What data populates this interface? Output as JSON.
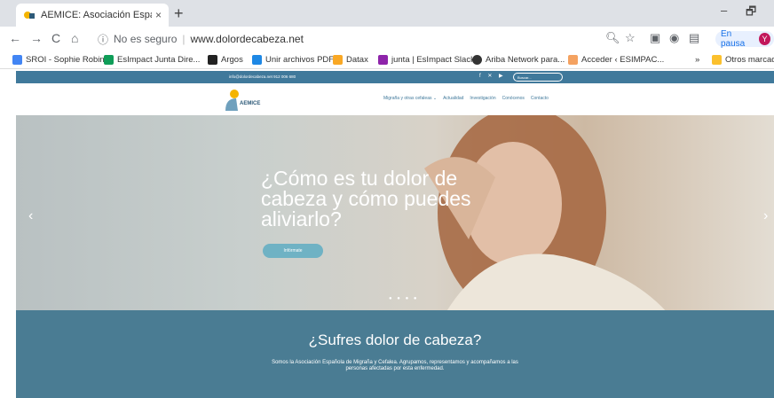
{
  "browser": {
    "tab_title": "AEMICE: Asociación Española de",
    "tab_close": "×",
    "new_tab": "+",
    "minimize": "–",
    "restore": "🗗",
    "back": "←",
    "forward": "→",
    "reload": "C",
    "home": "⌂",
    "security_label": "No es seguro",
    "url": "www.dolordecabeza.net",
    "paused_label": "En pausa",
    "avatar_letter": "Y"
  },
  "bookmarks": [
    {
      "label": "SROI - Sophie Robin",
      "color": "#4285f4"
    },
    {
      "label": "EsImpact Junta Dire...",
      "color": "#0f9d58"
    },
    {
      "label": "Argos",
      "color": "#222222"
    },
    {
      "label": "Unir archivos PDF",
      "color": "#1e88e5"
    },
    {
      "label": "Datax",
      "color": "#f9a825"
    },
    {
      "label": "junta | EsImpact Slack",
      "color": "#8e24aa"
    },
    {
      "label": "Ariba Network para...",
      "color": "#333333"
    },
    {
      "label": "Acceder ‹ ESIMPAC...",
      "color": "#f4a261"
    },
    {
      "label": "»",
      "color": ""
    },
    {
      "label": "Otros marcado",
      "color": "#fbc02d"
    }
  ],
  "site": {
    "topbar_contact": "info@dolordecabeza.net     912 006 680",
    "social": "f ✕ ▶",
    "search_placeholder": "Buscar...",
    "logo_name": "AEMICE",
    "menu": [
      "Migraña y otras cefaleas ⌄",
      "Actualidad",
      "Investigación",
      "Conócenos",
      "Contacto"
    ],
    "hero_title": "¿Cómo es tu dolor de cabeza y cómo puedes aliviarlo?",
    "hero_button": "Infórmate",
    "prev_arrow": "‹",
    "next_arrow": "›",
    "slider_dots": "● ● ● ●",
    "band_title": "¿Sufres dolor de cabeza?",
    "band_text": "Somos la Asociación Española de Migraña y Cefalea. Agrupamos, representamos y acompañamos a las personas afectadas por esta enfermedad."
  },
  "colors": {
    "topbar": "#40799b",
    "band": "#4a7c93",
    "button": "#6fb2c4"
  }
}
